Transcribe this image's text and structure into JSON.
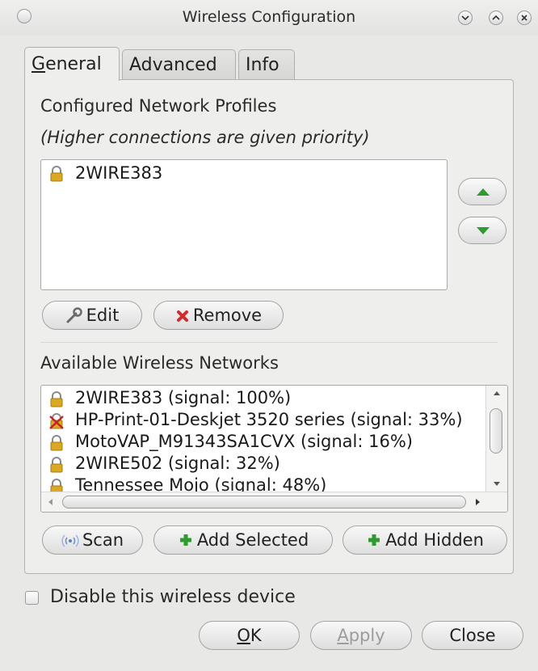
{
  "window": {
    "title": "Wireless Configuration",
    "controls": [
      "minimize",
      "maximize",
      "close"
    ]
  },
  "tabs": [
    {
      "label_underlined": "G",
      "label_rest": "eneral",
      "active": true
    },
    {
      "label": "Advanced",
      "active": false
    },
    {
      "label": "Info",
      "active": false
    }
  ],
  "profiles": {
    "heading": "Configured Network Profiles",
    "subheading": "(Higher connections are given priority)",
    "items": [
      {
        "name": "2WIRE383",
        "icon": "lock-icon"
      }
    ],
    "edit_label": "Edit",
    "remove_label": "Remove"
  },
  "available": {
    "heading": "Available Wireless Networks",
    "items": [
      {
        "text": "2WIRE383 (signal: 100%)",
        "icon": "lock-icon"
      },
      {
        "text": "HP-Print-01-Deskjet 3520 series (signal: 33%)",
        "icon": "unsecured-icon"
      },
      {
        "text": "MotoVAP_M91343SA1CVX (signal: 16%)",
        "icon": "lock-icon"
      },
      {
        "text": "2WIRE502 (signal: 32%)",
        "icon": "lock-icon"
      },
      {
        "text": "Tennessee Mojo (signal: 48%)",
        "icon": "lock-icon"
      }
    ],
    "scan_label": "Scan",
    "add_selected_label": "Add Selected",
    "add_hidden_label": "Add Hidden"
  },
  "disable_label": "Disable this wireless device",
  "disable_checked": false,
  "footer": {
    "ok_underlined": "O",
    "ok_rest": "K",
    "apply_underlined": "A",
    "apply_rest": "pply",
    "apply_enabled": false,
    "close_label": "Close"
  },
  "colors": {
    "accent_green": "#2f9a2f",
    "remove_red": "#d42a2a",
    "lock_gold": "#d9a81f"
  }
}
